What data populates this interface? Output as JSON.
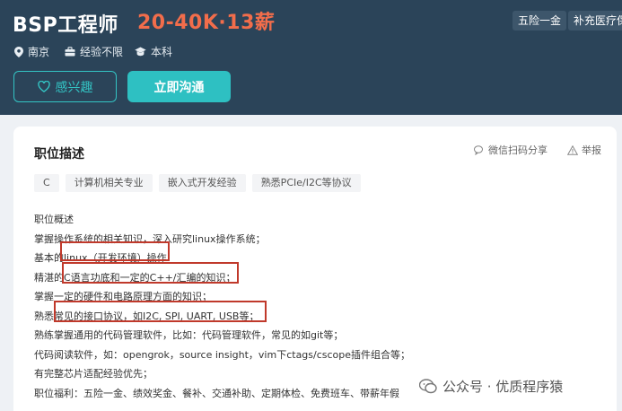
{
  "header": {
    "job_title": "BSP工程师",
    "salary": "20-40K·13薪",
    "benefits": [
      "五险一金",
      "补充医疗保险"
    ],
    "city": "南京",
    "experience": "经验不限",
    "education": "本科",
    "interest_button": "感兴趣",
    "chat_button": "立即沟通"
  },
  "card": {
    "title": "职位描述",
    "share_label": "微信扫码分享",
    "report_label": "举报",
    "tags": [
      "C",
      "计算机相关专业",
      "嵌入式开发经验",
      "熟悉PCIe/I2C等协议"
    ],
    "lines": [
      "职位概述",
      "掌握操作系统的相关知识，深入研究linux操作系统；",
      "基本的linux（开发环境）操作",
      "精湛的C语言功底和一定的C++/汇编的知识；",
      "掌握一定的硬件和电路原理方面的知识；",
      "熟悉常见的接口协议，如I2C, SPI, UART, USB等；",
      "熟练掌握通用的代码管理软件，比如：代码管理软件，常见的如git等；",
      "代码阅读软件，如：opengrok，source insight，vim下ctags/cscope插件组合等；",
      "有完整芯片适配经验优先；",
      "职位福利：五险一金、绩效奖金、餐补、交通补助、定期体检、免费班车、带薪年假"
    ]
  },
  "watermark": "公众号 · 优质程序猿",
  "colors": {
    "header_bg": "#2b4459",
    "salary": "#f26d4b",
    "accent": "#2ec0c2",
    "highlight_box": "#c0392b"
  }
}
